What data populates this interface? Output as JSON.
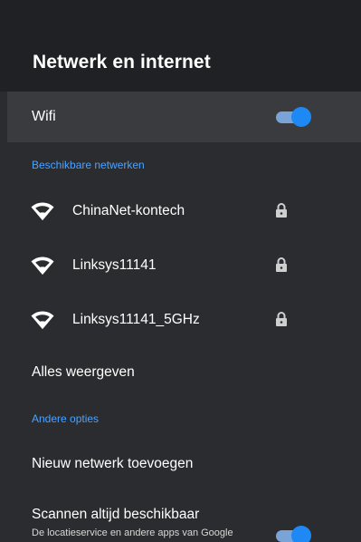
{
  "header": {
    "title": "Netwerk en internet"
  },
  "wifi": {
    "label": "Wifi",
    "enabled": true
  },
  "sections": {
    "available_networks": "Beschikbare netwerken",
    "other_options": "Andere opties"
  },
  "networks": [
    {
      "name": "ChinaNet-kontech",
      "icon": "wifi-full-icon",
      "secured": true,
      "lock_icon": "lock-icon"
    },
    {
      "name": "Linksys11141",
      "icon": "wifi-full-icon",
      "secured": true,
      "lock_icon": "lock-icon"
    },
    {
      "name": "Linksys11141_5GHz",
      "icon": "wifi-full-icon",
      "secured": true,
      "lock_icon": "lock-icon"
    }
  ],
  "show_all": "Alles weergeven",
  "options": {
    "add_network": "Nieuw netwerk toevoegen",
    "scan_always": {
      "title": "Scannen altijd beschikbaar",
      "description": "De locatieservice en andere apps van Google",
      "enabled": true
    }
  },
  "colors": {
    "background": "#2b2c2f",
    "header_background": "#202124",
    "selected_row": "#3a3b3e",
    "accent": "#4aa2ff",
    "toggle_knob": "#1e88f5",
    "toggle_track": "#7aa4d8"
  }
}
